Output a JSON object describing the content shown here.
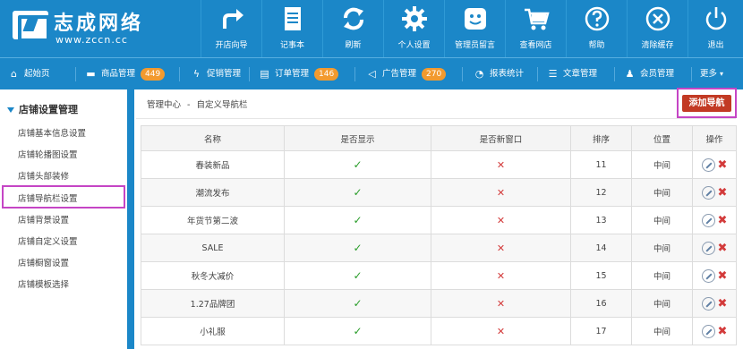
{
  "logo": {
    "title": "志成网络",
    "subtitle": "www.zccn.cc"
  },
  "toolbar": [
    {
      "label": "开店向导",
      "icon": "share-arrow-icon"
    },
    {
      "label": "记事本",
      "icon": "notepad-icon"
    },
    {
      "label": "刷新",
      "icon": "refresh-icon"
    },
    {
      "label": "个人设置",
      "icon": "gear-icon"
    },
    {
      "label": "管理员留言",
      "icon": "smile-message-icon"
    },
    {
      "label": "查看网店",
      "icon": "cart-icon"
    },
    {
      "label": "帮助",
      "icon": "help-icon"
    },
    {
      "label": "清除缓存",
      "icon": "clear-cache-icon"
    },
    {
      "label": "退出",
      "icon": "power-icon"
    }
  ],
  "nav": [
    {
      "label": "起始页",
      "icon": "home-icon"
    },
    {
      "label": "商品管理",
      "icon": "folder-icon",
      "badge": "449"
    },
    {
      "label": "促销管理",
      "icon": "lightning-icon"
    },
    {
      "label": "订单管理",
      "icon": "clipboard-icon",
      "badge": "146"
    },
    {
      "label": "广告管理",
      "icon": "megaphone-icon",
      "badge": "270"
    },
    {
      "label": "报表统计",
      "icon": "pie-chart-icon"
    },
    {
      "label": "文章管理",
      "icon": "list-icon"
    },
    {
      "label": "会员管理",
      "icon": "users-icon"
    },
    {
      "label": "更多",
      "icon": "chevron-down-icon"
    }
  ],
  "sidebar": {
    "heading": "店铺设置管理",
    "items": [
      "店铺基本信息设置",
      "店铺轮播图设置",
      "店铺头部装修",
      "店铺导航栏设置",
      "店铺背景设置",
      "店铺自定义设置",
      "店铺橱窗设置",
      "店铺模板选择"
    ]
  },
  "breadcrumb": {
    "root": "管理中心",
    "sep": "-",
    "current": "自定义导航栏"
  },
  "add_button": "添加导航",
  "table": {
    "headers": [
      "名称",
      "是否显示",
      "是否新窗口",
      "排序",
      "位置",
      "操作"
    ],
    "rows": [
      {
        "name": "春装新品",
        "order": "11",
        "position": "中间"
      },
      {
        "name": "潮流发布",
        "order": "12",
        "position": "中间"
      },
      {
        "name": "年货节第二波",
        "order": "13",
        "position": "中间"
      },
      {
        "name": "SALE",
        "order": "14",
        "position": "中间"
      },
      {
        "name": "秋冬大减价",
        "order": "15",
        "position": "中间"
      },
      {
        "name": "1.27品牌团",
        "order": "16",
        "position": "中间"
      },
      {
        "name": "小礼服",
        "order": "17",
        "position": "中间"
      }
    ],
    "check_glyph": "✓",
    "cross_glyph": "✕",
    "delete_glyph": "✖"
  },
  "colors": {
    "primary": "#1b87c8",
    "badge": "#f29a2e",
    "danger": "#c23a24",
    "highlight": "#c545c5",
    "check": "#2a9d2a"
  }
}
